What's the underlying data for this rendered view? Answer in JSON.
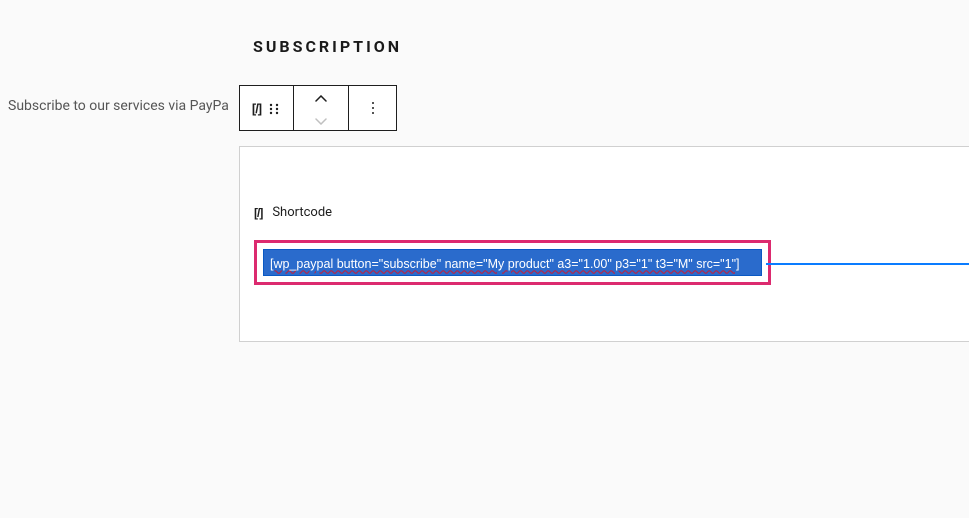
{
  "header": {
    "title": "SUBSCRIPTION",
    "subtitle": "Subscribe to our services via PayPa"
  },
  "toolbar": {
    "block_type_glyph": "[/]",
    "block_type_name": "shortcode-icon",
    "drag_name": "drag-handle-icon",
    "move_up_name": "chevron-up-icon",
    "move_down_name": "chevron-down-icon",
    "more_name": "more-vertical-icon"
  },
  "block": {
    "label_glyph": "[/]",
    "label": "Shortcode",
    "shortcode_value": "[wp_paypal button=\"subscribe\" name=\"My product\" a3=\"1.00\" p3=\"1\" t3=\"M\" src=\"1\"]"
  }
}
